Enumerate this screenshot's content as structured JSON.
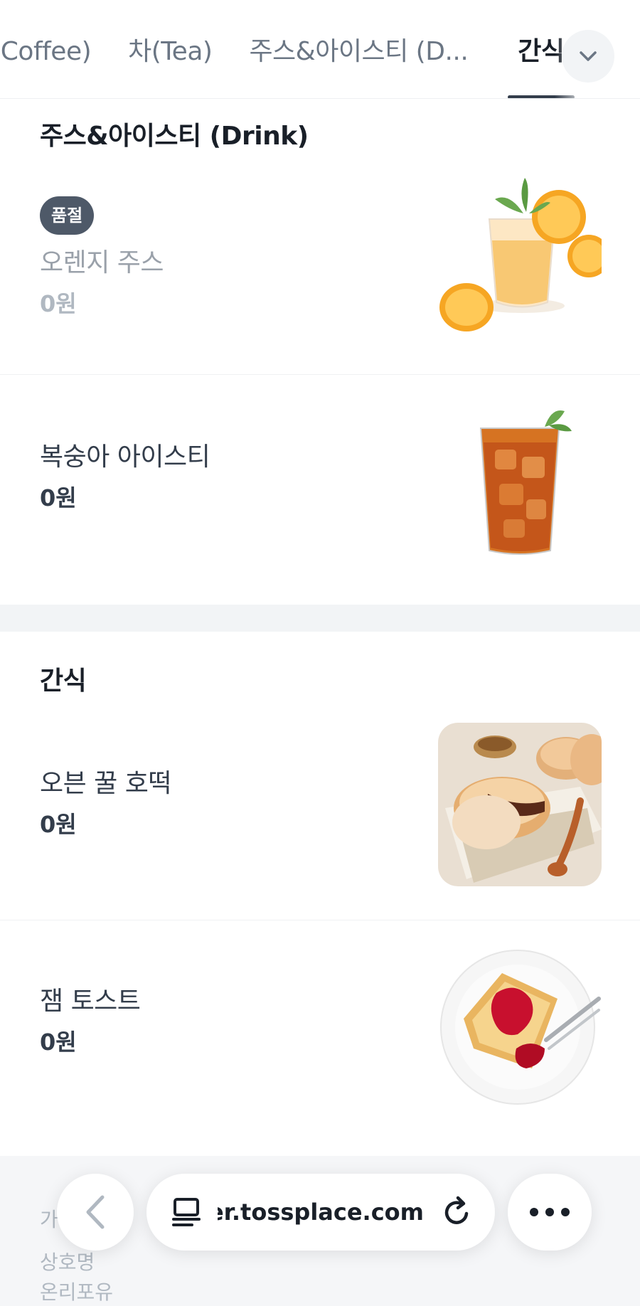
{
  "tabs": [
    {
      "label": "커피(Coffee)"
    },
    {
      "label": "차(Tea)"
    },
    {
      "label": "주스&아이스티 (D..."
    },
    {
      "label": "간식"
    }
  ],
  "sections": [
    {
      "title": "주스&아이스티 (Drink)",
      "items": [
        {
          "name": "오렌지 주스",
          "price": "0원",
          "badge": "품절"
        },
        {
          "name": "복숭아 아이스티",
          "price": "0원"
        }
      ]
    },
    {
      "title": "간식",
      "items": [
        {
          "name": "오븐 꿀 호떡",
          "price": "0원"
        },
        {
          "name": "잼 토스트",
          "price": "0원"
        }
      ]
    }
  ],
  "footer": {
    "line1": "가",
    "line2": "상호명",
    "line3": "온리포유"
  },
  "browser": {
    "url": "order.tossplace.com"
  },
  "colors": {
    "text": "#333d4b",
    "muted": "#9aa1aa",
    "badge": "#4e5968",
    "band": "#f2f4f6"
  }
}
